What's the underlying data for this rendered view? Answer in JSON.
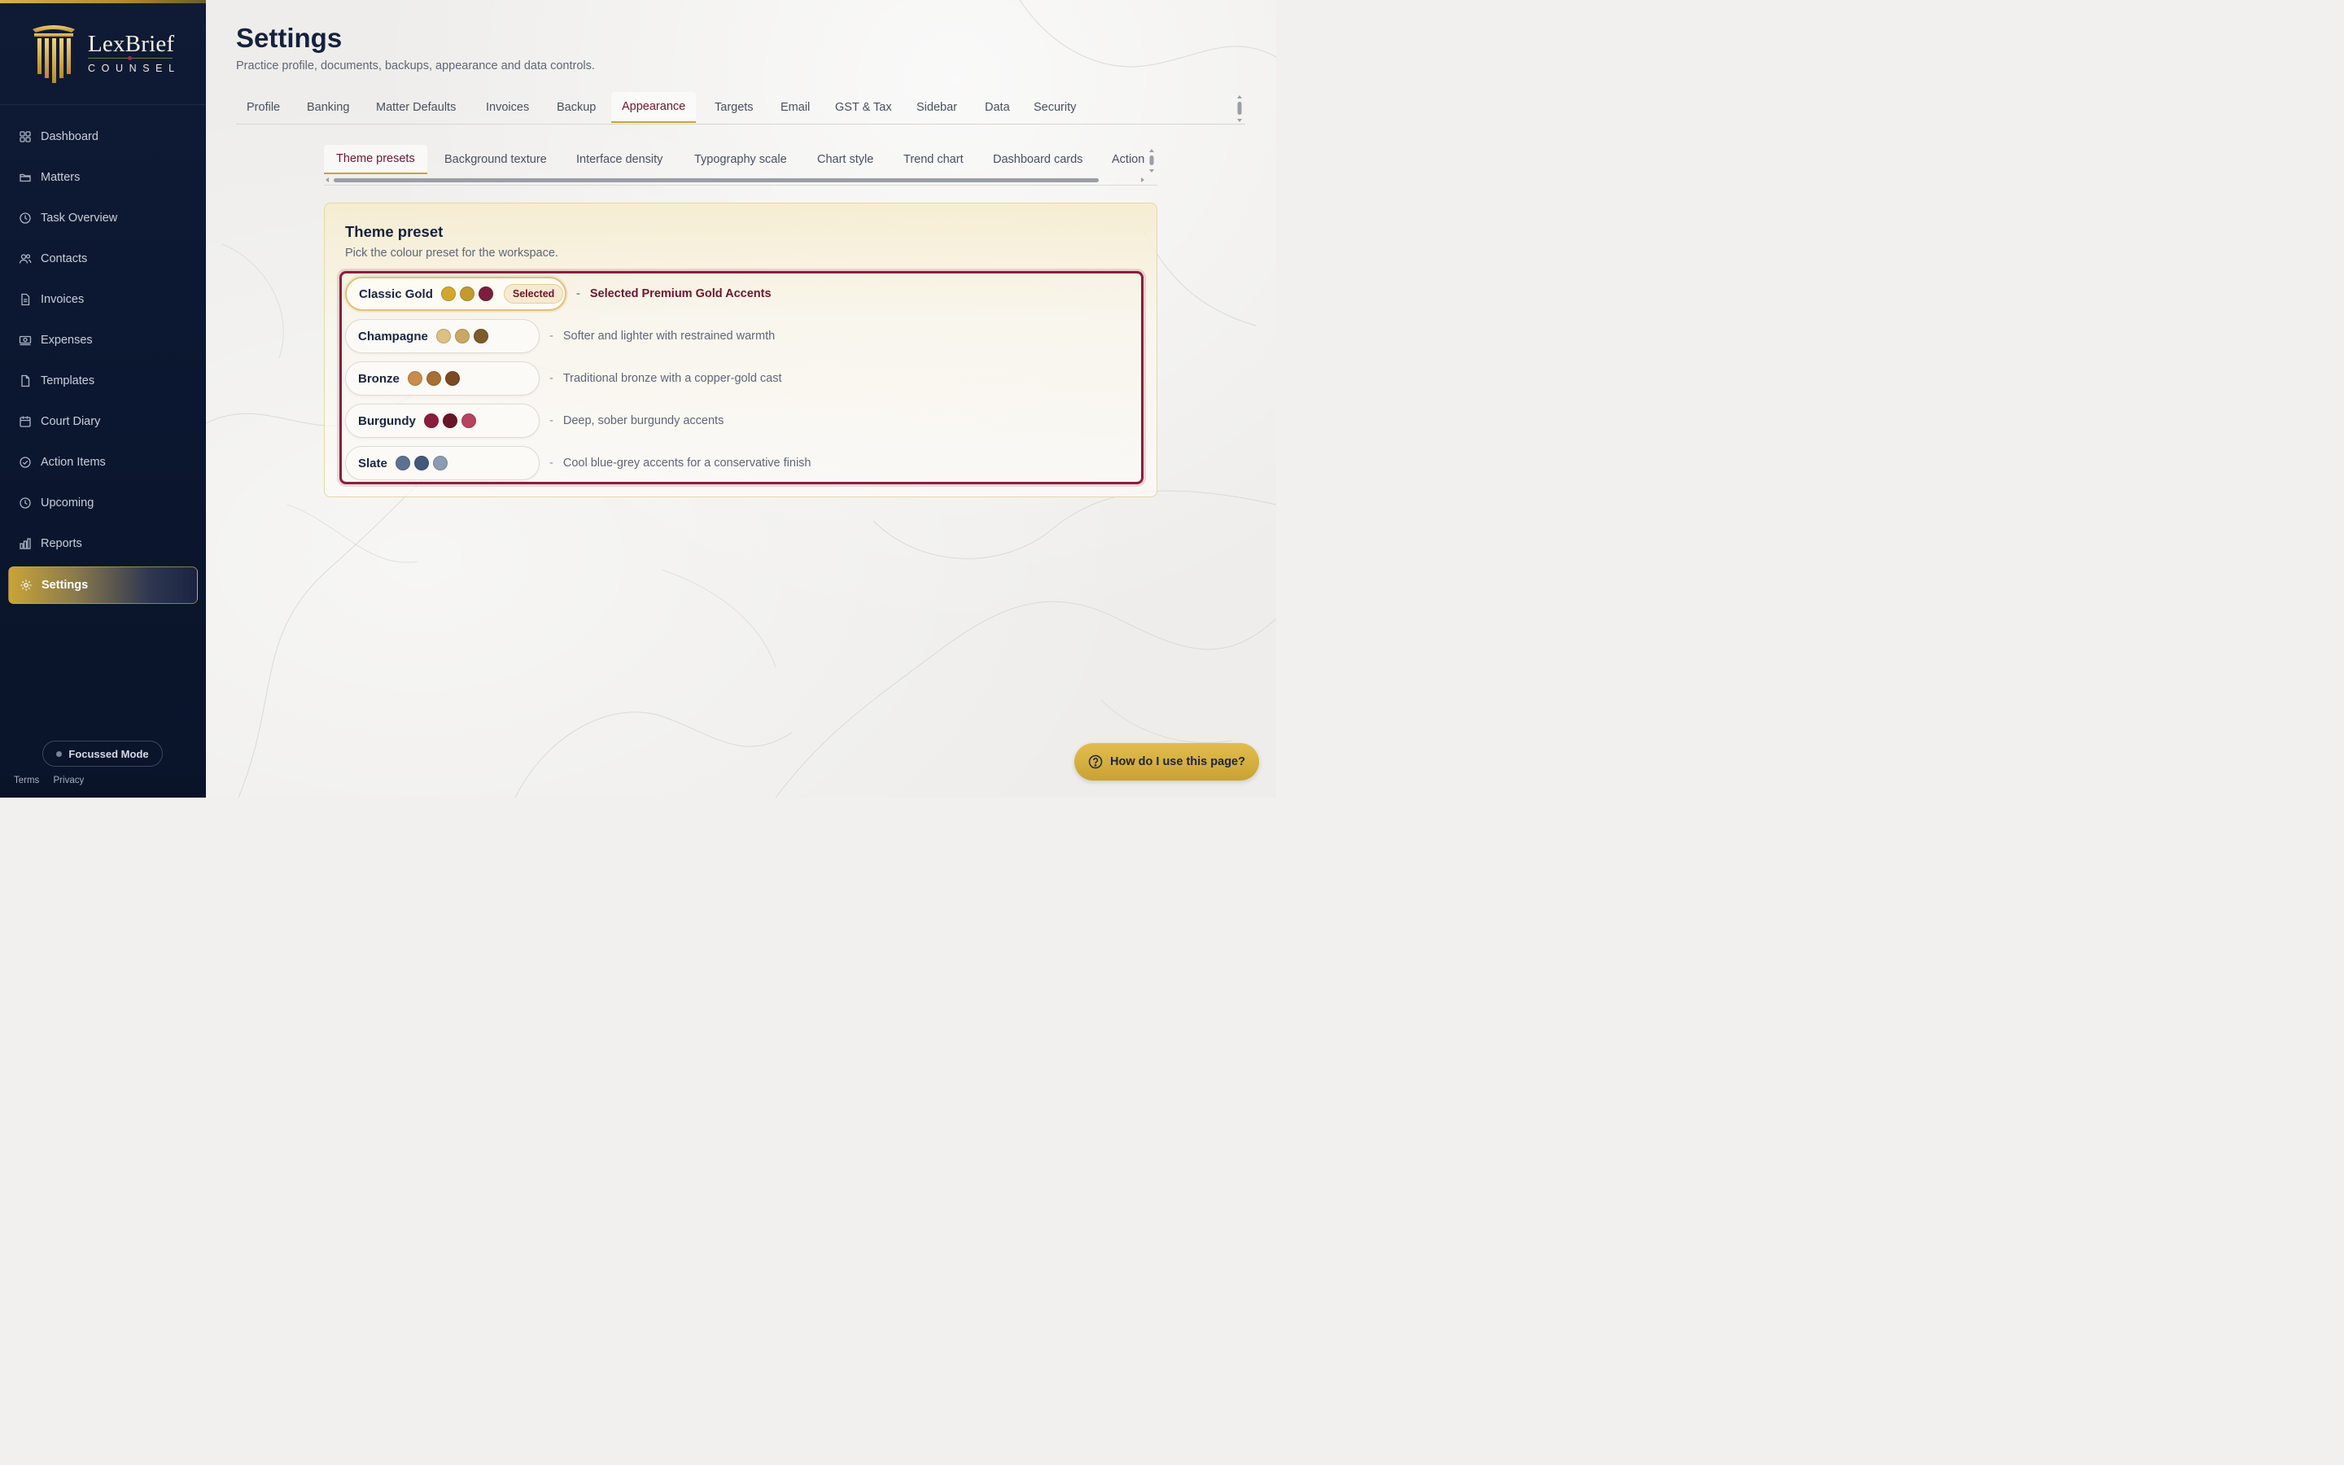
{
  "brand": {
    "name": "LexBrief",
    "tagline": "COUNSEL"
  },
  "sidebar": {
    "items": [
      {
        "label": "Dashboard",
        "icon": "dashboard-icon"
      },
      {
        "label": "Matters",
        "icon": "folder-icon"
      },
      {
        "label": "Task Overview",
        "icon": "clock-icon"
      },
      {
        "label": "Contacts",
        "icon": "users-icon"
      },
      {
        "label": "Invoices",
        "icon": "invoice-icon"
      },
      {
        "label": "Expenses",
        "icon": "cash-icon"
      },
      {
        "label": "Templates",
        "icon": "document-icon"
      },
      {
        "label": "Court Diary",
        "icon": "calendar-icon"
      },
      {
        "label": "Action Items",
        "icon": "check-circle-icon"
      },
      {
        "label": "Upcoming",
        "icon": "clock-icon"
      },
      {
        "label": "Reports",
        "icon": "bar-chart-icon"
      },
      {
        "label": "Settings",
        "icon": "gear-icon",
        "active": true
      }
    ],
    "focus_mode_label": "Focussed Mode",
    "footer_links": [
      "Terms",
      "Privacy"
    ]
  },
  "page": {
    "title": "Settings",
    "subtitle": "Practice profile, documents, backups, appearance and data controls."
  },
  "tabs": [
    "Profile",
    "Banking",
    "Matter Defaults",
    "Invoices",
    "Backup",
    "Appearance",
    "Targets",
    "Email",
    "GST & Tax",
    "Sidebar",
    "Data",
    "Security"
  ],
  "active_tab": "Appearance",
  "subtabs": [
    "Theme presets",
    "Background texture",
    "Interface density",
    "Typography scale",
    "Chart style",
    "Trend chart",
    "Dashboard cards",
    "Action"
  ],
  "active_subtab": "Theme presets",
  "card": {
    "title": "Theme preset",
    "subtitle": "Pick the colour preset for the workspace.",
    "selected_badge": "Selected",
    "dash": "-",
    "presets": [
      {
        "name": "Classic Gold",
        "description": "Selected Premium Gold Accents",
        "swatches": [
          "#d4a72c",
          "#c39a2c",
          "#7a1e3c"
        ],
        "selected": true
      },
      {
        "name": "Champagne",
        "description": "Softer and lighter with restrained warmth",
        "swatches": [
          "#dcc084",
          "#c9a866",
          "#7f5a2a"
        ]
      },
      {
        "name": "Bronze",
        "description": "Traditional bronze with a copper-gold cast",
        "swatches": [
          "#c88c4c",
          "#a96e32",
          "#7a4a25"
        ]
      },
      {
        "name": "Burgundy",
        "description": "Deep, sober burgundy accents",
        "swatches": [
          "#8a1d3c",
          "#6a1428",
          "#b5445f"
        ]
      },
      {
        "name": "Slate",
        "description": "Cool blue-grey accents for a conservative finish",
        "swatches": [
          "#5d7190",
          "#44597a",
          "#8b9bb3"
        ]
      }
    ]
  },
  "help_button": "How do I use this page?",
  "colors": {
    "accent": "#c9a437",
    "burgundy": "#8c1d3e",
    "navy": "#0f1b35"
  }
}
